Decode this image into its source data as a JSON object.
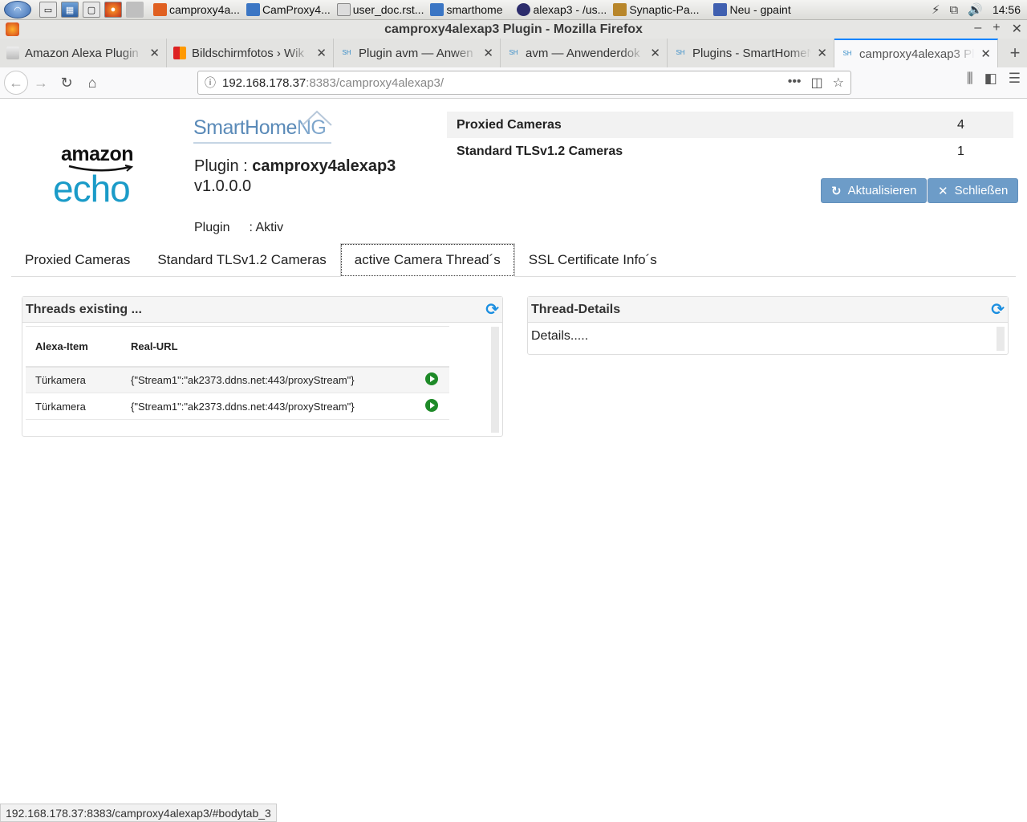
{
  "taskbar": {
    "tasks": [
      {
        "label": "camproxy4a...",
        "color": "#e06020"
      },
      {
        "label": "CamProxy4...",
        "color": "#3b76c4"
      },
      {
        "label": "user_doc.rst...",
        "color": "#dcdcdc"
      },
      {
        "label": "smarthome",
        "color": "#3b76c4"
      },
      {
        "label": "alexap3 - /us...",
        "color": "#2c2c6c"
      },
      {
        "label": "Synaptic-Pa...",
        "color": "#b8862a"
      },
      {
        "label": "Neu - gpaint",
        "color": "#4060b0"
      }
    ],
    "clock": "14:56"
  },
  "window": {
    "title": "camproxy4alexap3 Plugin - Mozilla Firefox"
  },
  "browser_tabs": [
    {
      "label": "Amazon Alexa Plugin"
    },
    {
      "label": "Bildschirmfotos › Wik"
    },
    {
      "label": "Plugin avm — Anwen"
    },
    {
      "label": "avm — Anwenderdok"
    },
    {
      "label": "Plugins - SmartHomeN"
    },
    {
      "label": "camproxy4alexap3 Plu"
    }
  ],
  "urlbar": {
    "host": "192.168.178.37",
    "rest": ":8383/camproxy4alexap3/"
  },
  "logos": {
    "amazon": "amazon",
    "echo": "echo",
    "shng_main": "SmartHome",
    "shng_suffix": "NG"
  },
  "plugin": {
    "label": "Plugin :",
    "name": "camproxy4alexap3",
    "version": "v1.0.0.0",
    "status_label": "Plugin",
    "status_value": ": Aktiv"
  },
  "summary": [
    {
      "label": "Proxied Cameras",
      "value": "4"
    },
    {
      "label": "Standard TLSv1.2 Cameras",
      "value": "1"
    }
  ],
  "buttons": {
    "refresh": "Aktualisieren",
    "close": "Schließen"
  },
  "page_tabs": [
    {
      "label": "Proxied Cameras"
    },
    {
      "label": "Standard TLSv1.2 Cameras"
    },
    {
      "label": "active Camera Thread´s"
    },
    {
      "label": "SSL Certificate Info´s"
    }
  ],
  "threads_panel": {
    "title": "Threads existing ...",
    "columns": [
      "Alexa-Item",
      "Real-URL"
    ],
    "rows": [
      {
        "item": "Türkamera",
        "url": "{\"Stream1\":\"ak2373.ddns.net:443/proxyStream\"}"
      },
      {
        "item": "Türkamera",
        "url": "{\"Stream1\":\"ak2373.ddns.net:443/proxyStream\"}"
      }
    ]
  },
  "details_panel": {
    "title": "Thread-Details",
    "body": "Details....."
  },
  "statusbar": "192.168.178.37:8383/camproxy4alexap3/#bodytab_3",
  "colors": {
    "accent": "#0a84ff",
    "button": "#6d9cc8",
    "play": "#1e8a28",
    "refresh_icon": "#1a8ee0"
  }
}
